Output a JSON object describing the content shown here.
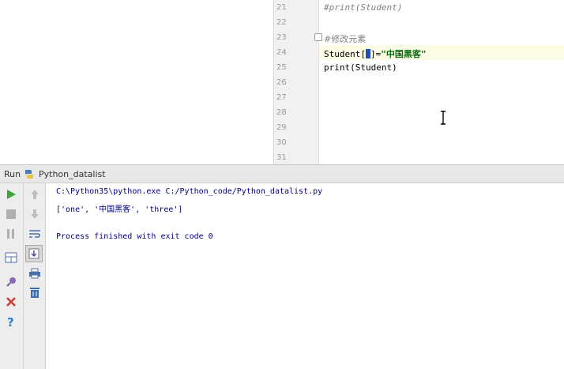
{
  "editor": {
    "lines": [
      {
        "num": "21",
        "text": "#print(Student)",
        "kind": "comment-italic"
      },
      {
        "num": "22",
        "text": "",
        "kind": "plain"
      },
      {
        "num": "23",
        "text": "#修改元素",
        "kind": "comment-plain"
      },
      {
        "num": "24",
        "text": "",
        "kind": "current"
      },
      {
        "num": "25",
        "text": "print(Student)",
        "kind": "plain"
      },
      {
        "num": "26",
        "text": "",
        "kind": "plain"
      },
      {
        "num": "27",
        "text": "",
        "kind": "plain"
      },
      {
        "num": "28",
        "text": "",
        "kind": "plain"
      },
      {
        "num": "29",
        "text": "",
        "kind": "plain"
      },
      {
        "num": "30",
        "text": "",
        "kind": "plain"
      },
      {
        "num": "31",
        "text": "",
        "kind": "plain"
      }
    ],
    "line24": {
      "before": "Student[",
      "after": "]=",
      "string": "\"中国黑客\""
    }
  },
  "run": {
    "label": "Run",
    "config_name": "Python_datalist"
  },
  "console": {
    "lines": [
      "C:\\Python35\\python.exe C:/Python_code/Python_datalist.py",
      "['one', '中国黑客', 'three']",
      "",
      "Process finished with exit code 0"
    ]
  },
  "colors": {
    "run_green": "#3aa33a",
    "stop_gray": "#b0b0b0",
    "close_red": "#d33a2c",
    "help_blue": "#2f7fd0",
    "console_text": "#000080"
  },
  "icons": [
    "python-icon",
    "run-icon",
    "stop-icon",
    "pause-icon",
    "up-arrow-icon",
    "down-arrow-icon",
    "soft-wrap-icon",
    "scroll-to-end-icon",
    "layout-icon",
    "print-icon",
    "pin-icon",
    "trash-icon",
    "close-icon",
    "help-icon"
  ]
}
